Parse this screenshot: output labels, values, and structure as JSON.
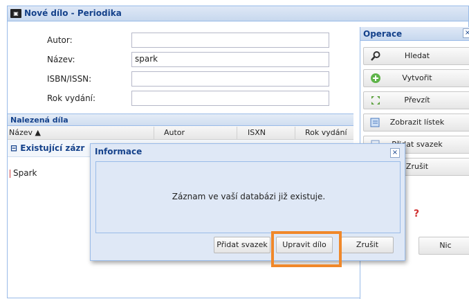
{
  "window": {
    "title": "Nové dílo - Periodika",
    "icon": "app-icon"
  },
  "form": {
    "author_label": "Autor:",
    "author_value": "",
    "name_label": "Název:",
    "name_value": "spark",
    "isbn_label": "ISBN/ISSN:",
    "isbn_value": "",
    "year_label": "Rok vydání:",
    "year_value": ""
  },
  "found": {
    "header": "Nalezená díla",
    "columns": [
      "Název ▲",
      "Autor",
      "ISXN",
      "Rok vydání"
    ],
    "group_label": "Existující zázr",
    "rows": [
      "Spark"
    ]
  },
  "ops": {
    "title": "Operace",
    "buttons": [
      "Hledat",
      "Vytvořit",
      "Převzít",
      "Zobrazit lístek",
      "Přidat svazek",
      "Zrušit"
    ],
    "bottom_button": "Nic",
    "close_glyph": "×"
  },
  "dialog": {
    "title": "Informace",
    "message": "Záznam ve vaší databázi již existuje.",
    "buttons": [
      "Přidat svazek",
      "Upravit dílo",
      "Zrušit"
    ],
    "close_glyph": "×",
    "highlight_color": "#f0882a"
  }
}
